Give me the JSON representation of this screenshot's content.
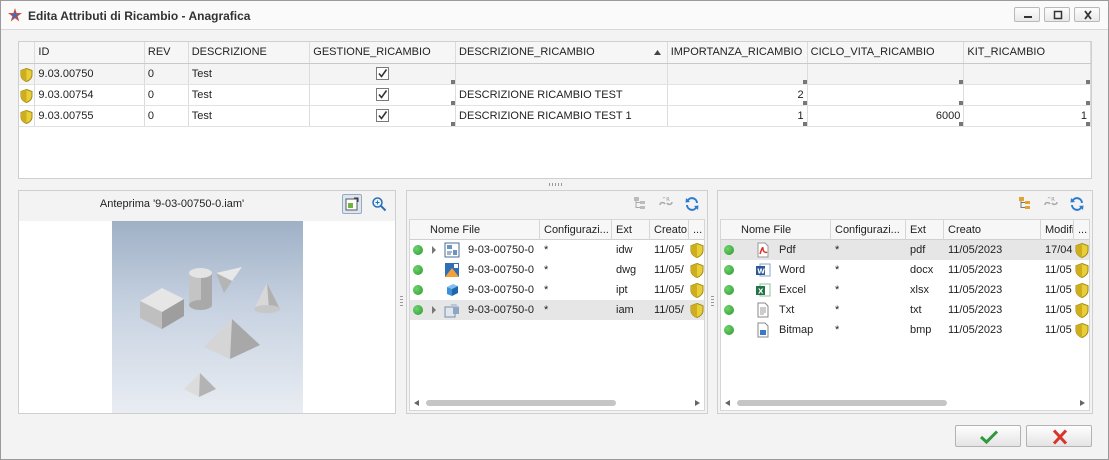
{
  "window": {
    "title": "Edita Attributi di Ricambio - Anagrafica"
  },
  "grid": {
    "columns": [
      "ID",
      "REV",
      "DESCRIZIONE",
      "GESTIONE_RICAMBIO",
      "DESCRIZIONE_RICAMBIO",
      "IMPORTANZA_RICAMBIO",
      "CICLO_VITA_RICAMBIO",
      "KIT_RICAMBIO"
    ],
    "sorted_column": "DESCRIZIONE_RICAMBIO",
    "rows": [
      {
        "id": "9.03.00750",
        "rev": "0",
        "descrizione": "Test",
        "gestione": true,
        "descrizione_ricambio": "",
        "importanza": "",
        "ciclo_vita": "",
        "kit": ""
      },
      {
        "id": "9.03.00754",
        "rev": "0",
        "descrizione": "Test",
        "gestione": true,
        "descrizione_ricambio": "DESCRIZIONE RICAMBIO TEST",
        "importanza": "2",
        "ciclo_vita": "",
        "kit": ""
      },
      {
        "id": "9.03.00755",
        "rev": "0",
        "descrizione": "Test",
        "gestione": true,
        "descrizione_ricambio": "DESCRIZIONE RICAMBIO TEST 1",
        "importanza": "1",
        "ciclo_vita": "6000",
        "kit": "1"
      }
    ]
  },
  "preview": {
    "title": "Anteprima '9-03-00750-0.iam'"
  },
  "files_panel": {
    "columns": [
      "Nome File",
      "Configurazi...",
      "Ext",
      "Creato",
      "..."
    ],
    "rows": [
      {
        "name": "9-03-00750-0",
        "config": "*",
        "ext": "idw",
        "created": "11/05/",
        "icon": "drawing-icon",
        "selected": false
      },
      {
        "name": "9-03-00750-0",
        "config": "*",
        "ext": "dwg",
        "created": "11/05/",
        "icon": "dwg-icon",
        "selected": false
      },
      {
        "name": "9-03-00750-0",
        "config": "*",
        "ext": "ipt",
        "created": "11/05/",
        "icon": "part-icon",
        "selected": false
      },
      {
        "name": "9-03-00750-0",
        "config": "*",
        "ext": "iam",
        "created": "11/05/",
        "icon": "assembly-icon",
        "selected": true
      }
    ]
  },
  "docs_panel": {
    "columns": [
      "Nome File",
      "Configurazi...",
      "Ext",
      "Creato",
      "Modifi",
      "..."
    ],
    "rows": [
      {
        "name": "Pdf",
        "config": "*",
        "ext": "pdf",
        "created": "11/05/2023",
        "modified": "17/04",
        "icon": "pdf-icon",
        "selected": true
      },
      {
        "name": "Word",
        "config": "*",
        "ext": "docx",
        "created": "11/05/2023",
        "modified": "11/05",
        "icon": "word-icon",
        "selected": false
      },
      {
        "name": "Excel",
        "config": "*",
        "ext": "xlsx",
        "created": "11/05/2023",
        "modified": "11/05",
        "icon": "excel-icon",
        "selected": false
      },
      {
        "name": "Txt",
        "config": "*",
        "ext": "txt",
        "created": "11/05/2023",
        "modified": "11/05",
        "icon": "text-file-icon",
        "selected": false
      },
      {
        "name": "Bitmap",
        "config": "*",
        "ext": "bmp",
        "created": "11/05/2023",
        "modified": "11/05",
        "icon": "bitmap-icon",
        "selected": false
      }
    ]
  },
  "colors": {
    "status_green": "#2a9a2a",
    "confirm_green": "#2e9a3c",
    "cancel_red": "#d9342b",
    "refresh_blue": "#2a7bd1"
  }
}
